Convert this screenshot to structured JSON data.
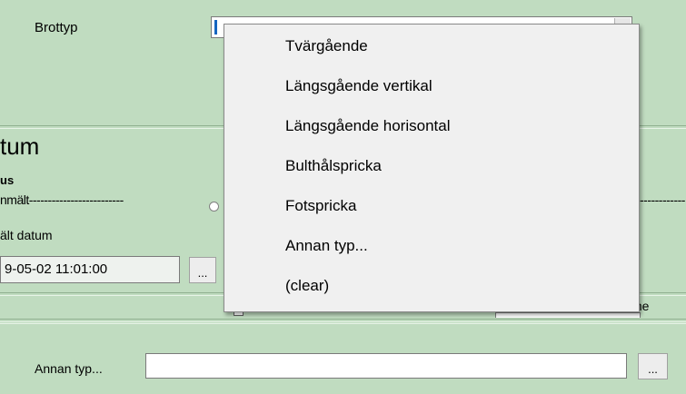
{
  "top": {
    "brottyp_label": "Brottyp"
  },
  "datum_section": {
    "title": "tum",
    "status_label": "us",
    "anmalt_line": "nmält-------------------------",
    "right_dashes": "------------",
    "valt_datum_label": "ält datum",
    "datetime_value": "9-05-02 11:01:00",
    "picker_button": "...",
    "partial_right_text": "me"
  },
  "dropdown": {
    "items": [
      "Tvärgående",
      "Längsgående vertikal",
      "Längsgående horisontal",
      "Bulthålspricka",
      "Fotspricka",
      "Annan typ...",
      "(clear)"
    ]
  },
  "bottom": {
    "annan_typ_label": "Annan typ...",
    "annan_typ_value": "",
    "browse_button": "..."
  }
}
